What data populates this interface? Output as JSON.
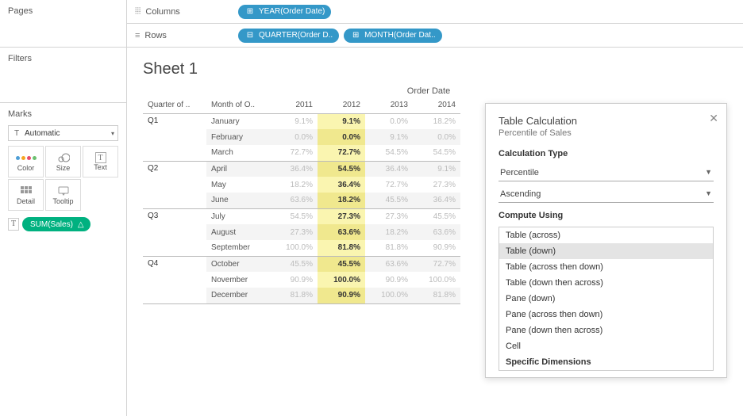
{
  "left": {
    "pages_title": "Pages",
    "filters_title": "Filters",
    "marks_title": "Marks",
    "mark_type": "Automatic",
    "cells": {
      "color": "Color",
      "size": "Size",
      "text": "Text",
      "detail": "Detail",
      "tooltip": "Tooltip"
    },
    "sum_pill": "SUM(Sales)"
  },
  "shelves": {
    "columns_label": "Columns",
    "rows_label": "Rows",
    "year_pill": "YEAR(Order Date)",
    "quarter_pill": "QUARTER(Order D..",
    "month_pill": "MONTH(Order Dat.."
  },
  "sheet": {
    "title": "Sheet 1",
    "axis_label": "Order Date",
    "headers": {
      "quarter": "Quarter of ..",
      "month": "Month of O..",
      "y2011": "2011",
      "y2012": "2012",
      "y2013": "2013",
      "y2014": "2014"
    },
    "rows": [
      {
        "q": "Q1",
        "m": "January",
        "v": [
          "9.1%",
          "9.1%",
          "0.0%",
          "18.2%"
        ]
      },
      {
        "q": "",
        "m": "February",
        "v": [
          "0.0%",
          "0.0%",
          "9.1%",
          "0.0%"
        ],
        "alt": true
      },
      {
        "q": "",
        "m": "March",
        "v": [
          "72.7%",
          "72.7%",
          "54.5%",
          "54.5%"
        ],
        "qend": true
      },
      {
        "q": "Q2",
        "m": "April",
        "v": [
          "36.4%",
          "54.5%",
          "36.4%",
          "9.1%"
        ],
        "alt": true
      },
      {
        "q": "",
        "m": "May",
        "v": [
          "18.2%",
          "36.4%",
          "72.7%",
          "27.3%"
        ]
      },
      {
        "q": "",
        "m": "June",
        "v": [
          "63.6%",
          "18.2%",
          "45.5%",
          "36.4%"
        ],
        "alt": true,
        "qend": true
      },
      {
        "q": "Q3",
        "m": "July",
        "v": [
          "54.5%",
          "27.3%",
          "27.3%",
          "45.5%"
        ]
      },
      {
        "q": "",
        "m": "August",
        "v": [
          "27.3%",
          "63.6%",
          "18.2%",
          "63.6%"
        ],
        "alt": true
      },
      {
        "q": "",
        "m": "September",
        "v": [
          "100.0%",
          "81.8%",
          "81.8%",
          "90.9%"
        ],
        "qend": true
      },
      {
        "q": "Q4",
        "m": "October",
        "v": [
          "45.5%",
          "45.5%",
          "63.6%",
          "72.7%"
        ],
        "alt": true
      },
      {
        "q": "",
        "m": "November",
        "v": [
          "90.9%",
          "100.0%",
          "90.9%",
          "100.0%"
        ]
      },
      {
        "q": "",
        "m": "December",
        "v": [
          "81.8%",
          "90.9%",
          "100.0%",
          "81.8%"
        ],
        "alt": true,
        "qend": true
      }
    ]
  },
  "tablecalc": {
    "title": "Table Calculation",
    "subtitle": "Percentile of Sales",
    "calc_type_label": "Calculation Type",
    "calc_type": "Percentile",
    "sort": "Ascending",
    "compute_label": "Compute Using",
    "options": [
      "Table (across)",
      "Table (down)",
      "Table (across then down)",
      "Table (down then across)",
      "Pane (down)",
      "Pane (across then down)",
      "Pane (down then across)",
      "Cell",
      "Specific Dimensions"
    ],
    "selected": "Table (down)"
  }
}
